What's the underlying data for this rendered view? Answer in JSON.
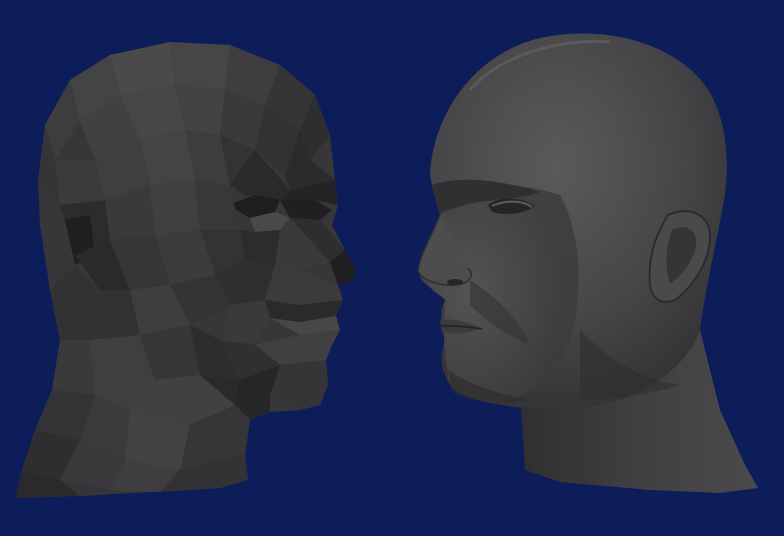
{
  "scene": {
    "background_color": "#0d1d5a",
    "models": [
      {
        "name": "low-poly-head",
        "shading": "flat",
        "facing": "right",
        "color": "#3a3a3c"
      },
      {
        "name": "smooth-head",
        "shading": "smooth",
        "facing": "left",
        "color": "#454547"
      }
    ]
  }
}
